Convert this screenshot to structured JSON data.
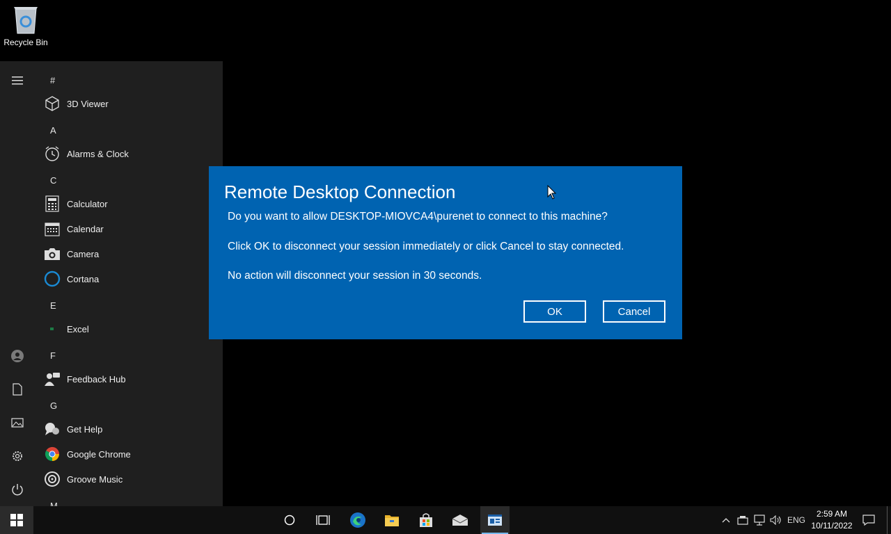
{
  "desktop": {
    "recycle_bin_label": "Recycle Bin"
  },
  "start_menu": {
    "sections": [
      {
        "letter": "#",
        "apps": [
          "3D Viewer"
        ]
      },
      {
        "letter": "A",
        "apps": [
          "Alarms & Clock"
        ]
      },
      {
        "letter": "C",
        "apps": [
          "Calculator",
          "Calendar",
          "Camera",
          "Cortana"
        ]
      },
      {
        "letter": "E",
        "apps": [
          "Excel"
        ]
      },
      {
        "letter": "F",
        "apps": [
          "Feedback Hub"
        ]
      },
      {
        "letter": "G",
        "apps": [
          "Get Help",
          "Google Chrome",
          "Groove Music"
        ]
      },
      {
        "letter": "M",
        "apps": []
      }
    ],
    "rail_icons": [
      "hamburger-menu-icon",
      "user-account-icon",
      "documents-icon",
      "pictures-icon",
      "settings-icon",
      "power-icon"
    ]
  },
  "dialog": {
    "title": "Remote Desktop Connection",
    "line1": "Do you want to allow DESKTOP-MIOVCA4\\purenet to connect to this machine?",
    "line2": "Click OK to disconnect your session immediately or click Cancel to stay connected.",
    "line3": "No action will disconnect your session in 30 seconds.",
    "ok_label": "OK",
    "cancel_label": "Cancel",
    "background_color": "#0063b1"
  },
  "taskbar": {
    "pinned": [
      "cortana-search-icon",
      "task-view-icon",
      "edge-icon",
      "file-explorer-icon",
      "store-icon",
      "mail-icon",
      "remote-desktop-icon"
    ],
    "language": "ENG",
    "time": "2:59 AM",
    "date": "10/11/2022"
  }
}
